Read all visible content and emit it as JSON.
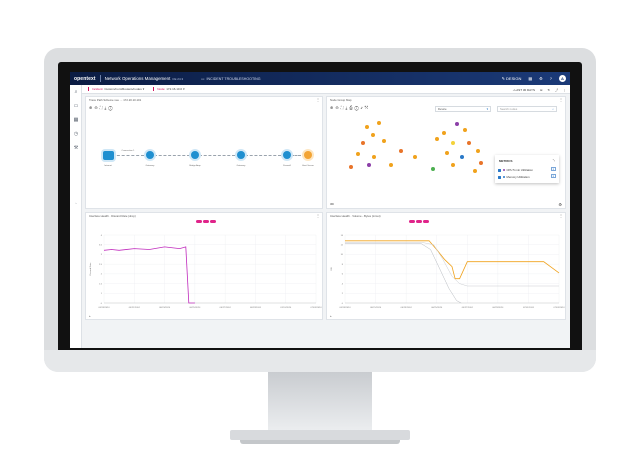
{
  "topbar": {
    "brand": "opentext",
    "app_title": "Network Operations Management",
    "version": "CE 24.3",
    "incident": "INCIDENT TROUBLESHOOTING",
    "user_label": "DESIGN",
    "avatar": "A"
  },
  "filters": {
    "chip1_key": "Incident:",
    "chip1_value": "Custom/nom/Routers/nodes",
    "chip2_key": "Node:",
    "chip2_value": "172.16.10.0",
    "time_label": "LAST 30 DAYS"
  },
  "path_panel": {
    "title": "Trace Path Scheme vue ··· 172.20.10.101",
    "edge_label": "Connection 1",
    "nodes": [
      "Internet",
      "Gateway",
      "Bridge Amp",
      "Gateway",
      "Firewall",
      "Host Server"
    ]
  },
  "group_panel": {
    "title": "Node Group Map",
    "dropdown": "Device",
    "search_placeholder": "Search nodes",
    "footer_left": "3D",
    "metrics_title": "METRICS",
    "metric1": "CPU 5 min Utilization",
    "metric2": "Memory Utilization"
  },
  "chart_left": {
    "title": "Interface Health · Discard Rate (drop)",
    "ylabel": "Discard Rate",
    "ytick_labels": [
      "0",
      "1",
      "1.5",
      "2",
      "2.5",
      "3",
      "3.5",
      "4"
    ],
    "xtick_labels": [
      "06/19/2024",
      "06/21/2024",
      "06/23/2024",
      "06/25/2024",
      "06/27/2024",
      "06/29/2024",
      "07/01/2024",
      "07/03/2024"
    ]
  },
  "chart_right": {
    "title": "Interface Health · Volume - Bytes (in/out)",
    "ylabel": "GB",
    "ytick_labels": [
      "0",
      "2",
      "4",
      "6",
      "8",
      "10",
      "12",
      "14"
    ],
    "xtick_labels": [
      "06/19/2024",
      "06/21/2024",
      "06/23/2024",
      "06/25/2024",
      "06/27/2024",
      "06/29/2024",
      "07/01/2024",
      "07/03/2024"
    ]
  },
  "colors": {
    "accent": "#d4135f",
    "line_left": "#c02bbd",
    "line_right": "#f0a21c",
    "brand_dark": "#0b1c43"
  },
  "chart_data": [
    {
      "type": "line",
      "ylim": [
        0,
        4
      ],
      "xlim": [
        0,
        14
      ],
      "series": [
        {
          "x": [
            0,
            0.5,
            1,
            2,
            3,
            4,
            5,
            5.4,
            5.6,
            6
          ],
          "values": [
            3.1,
            3.15,
            3.1,
            3.2,
            3.15,
            3.3,
            3.2,
            3.3,
            0,
            0
          ]
        }
      ]
    },
    {
      "type": "line",
      "ylim": [
        0,
        14
      ],
      "xlim": [
        0,
        14
      ],
      "series": [
        {
          "x": [
            0,
            1,
            2,
            3,
            4,
            5,
            5.5,
            6,
            6.5,
            7,
            7.2,
            7.5,
            8,
            9,
            10,
            11,
            12,
            13,
            14
          ],
          "values": [
            12.8,
            12.8,
            12.8,
            12.8,
            12.8,
            12.8,
            12.8,
            11,
            9,
            7.5,
            5,
            5,
            8.5,
            8.5,
            8.5,
            8.5,
            8.5,
            8.5,
            6.2
          ]
        },
        {
          "x": [
            0,
            5,
            5.8,
            6.4,
            7,
            7.5,
            8,
            14
          ],
          "values": [
            12.5,
            12.5,
            12,
            9,
            5.5,
            4,
            3.5,
            3.5
          ]
        },
        {
          "x": [
            0,
            5,
            5.6,
            6.2,
            6.8,
            7.3,
            7.6
          ],
          "values": [
            12.2,
            12.2,
            11,
            7,
            3,
            0.5,
            0
          ]
        }
      ]
    }
  ]
}
